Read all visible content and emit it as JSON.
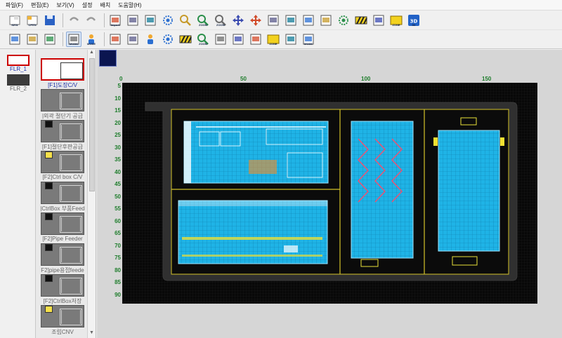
{
  "menu": [
    "파일(F)",
    "편집(E)",
    "보기(V)",
    "설정",
    "배치",
    "도움말(H)"
  ],
  "toolbar1": [
    {
      "name": "new-icon",
      "cap": "NEW"
    },
    {
      "name": "open-icon",
      "cap": "OPEN"
    },
    {
      "name": "save-icon",
      "cap": ""
    },
    {
      "name": "undo-icon",
      "cap": ""
    },
    {
      "name": "redo-icon",
      "cap": ""
    },
    {
      "name": "import-icon",
      "cap": "Import"
    },
    {
      "name": "layers-icon",
      "cap": ""
    },
    {
      "name": "image-icon",
      "cap": ""
    },
    {
      "name": "settings-gear-icon",
      "cap": ""
    },
    {
      "name": "zoom-fit-icon",
      "cap": ""
    },
    {
      "name": "zoom-in-icon",
      "cap": "ZOOM"
    },
    {
      "name": "zoom-out-icon",
      "cap": "ZOOM"
    },
    {
      "name": "move-pan-icon",
      "cap": ""
    },
    {
      "name": "move-select-icon",
      "cap": ""
    },
    {
      "name": "map-icon",
      "cap": ""
    },
    {
      "name": "truck-icon",
      "cap": ""
    },
    {
      "name": "print-icon",
      "cap": ""
    },
    {
      "name": "picture-icon",
      "cap": ""
    },
    {
      "name": "robot-icon",
      "cap": ""
    },
    {
      "name": "barrier-icon",
      "cap": ""
    },
    {
      "name": "grid-icon",
      "cap": ""
    },
    {
      "name": "zone-icon",
      "cap": "ZONE"
    },
    {
      "name": "view-3d-icon",
      "cap": "3D"
    }
  ],
  "toolbar2": [
    {
      "name": "drawing-icon",
      "cap": ""
    },
    {
      "name": "photo-icon",
      "cap": ""
    },
    {
      "name": "object-icon",
      "cap": ""
    },
    {
      "name": "mode-icon",
      "cap": "MODE",
      "active": true
    },
    {
      "name": "person-icon",
      "cap": "MODE"
    },
    {
      "name": "printer-icon",
      "cap": ""
    },
    {
      "name": "monitor-icon",
      "cap": ""
    },
    {
      "name": "people-icon",
      "cap": ""
    },
    {
      "name": "machine-icon",
      "cap": ""
    },
    {
      "name": "hazard-icon",
      "cap": ""
    },
    {
      "name": "zoom-out-2-icon",
      "cap": "ZOOM"
    },
    {
      "name": "chart-icon",
      "cap": ""
    },
    {
      "name": "paint-icon",
      "cap": ""
    },
    {
      "name": "crane-icon",
      "cap": ""
    },
    {
      "name": "zone-2-icon",
      "cap": "ZONE"
    },
    {
      "name": "conveyor-icon",
      "cap": ""
    },
    {
      "name": "mode-2-icon",
      "cap": "MODE"
    }
  ],
  "floors": [
    {
      "label": "FLR_1",
      "selected": true
    },
    {
      "label": "FLR_2",
      "selected": false
    }
  ],
  "modules": [
    {
      "label": "[F1]도장C/V",
      "badge": "none",
      "selected": true
    },
    {
      "label": "|외곽 절단기 공급",
      "badge": "none",
      "selected": false
    },
    {
      "label": "[F1]절단후판공급",
      "badge": "dark",
      "selected": false
    },
    {
      "label": "[F2]Ctrl box C/V",
      "badge": "yellow",
      "selected": false
    },
    {
      "label": "|CtrlBox 부품Feed",
      "badge": "dark",
      "selected": false
    },
    {
      "label": "[F2]Pipe Feeder",
      "badge": "dark",
      "selected": false
    },
    {
      "label": "F2]pipe용접feede",
      "badge": "dark",
      "selected": false
    },
    {
      "label": "[F2]CtrlBox저장",
      "badge": "dark",
      "selected": false
    },
    {
      "label": "조립CNV",
      "badge": "yellow",
      "selected": false
    }
  ],
  "ruler": {
    "x": [
      "0",
      "50",
      "100",
      "150"
    ],
    "y": [
      "5",
      "10",
      "15",
      "20",
      "25",
      "30",
      "35",
      "40",
      "45",
      "50",
      "55",
      "60",
      "65",
      "70",
      "75",
      "80",
      "85",
      "90"
    ]
  },
  "colors": {
    "accent": "#1b2fa8",
    "floor_bg": "#1a1a1a",
    "machine_cyan": "#1fb3e6",
    "zone_border": "#d4c32a",
    "aisle": "#303030",
    "ruler_text": "#1e7d2c"
  }
}
